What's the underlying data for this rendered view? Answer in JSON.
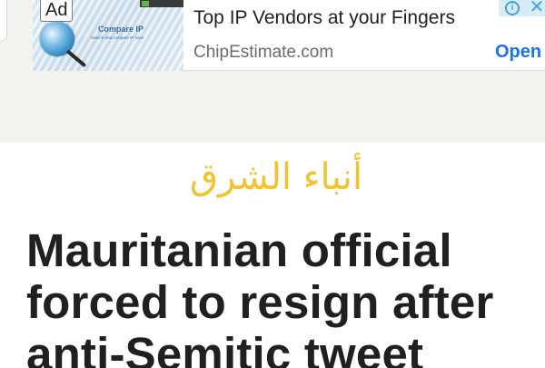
{
  "ad": {
    "badge": "Ad",
    "image": {
      "title": "Compare IP",
      "subtitle": "Search and compare IP now!"
    },
    "headline": "Top IP Vendors at your Fingers",
    "domain": "ChipEstimate.com",
    "cta": "Open",
    "adchoices_icon": "info-icon",
    "close_icon": "close-icon",
    "accent_color": "#1a73e8"
  },
  "article": {
    "site_logo": "أنباء الشرق",
    "headline_lines": [
      "Mauritanian official",
      "forced to resign after",
      "anti-Semitic tweet"
    ],
    "logo_color": "#f2c230"
  }
}
